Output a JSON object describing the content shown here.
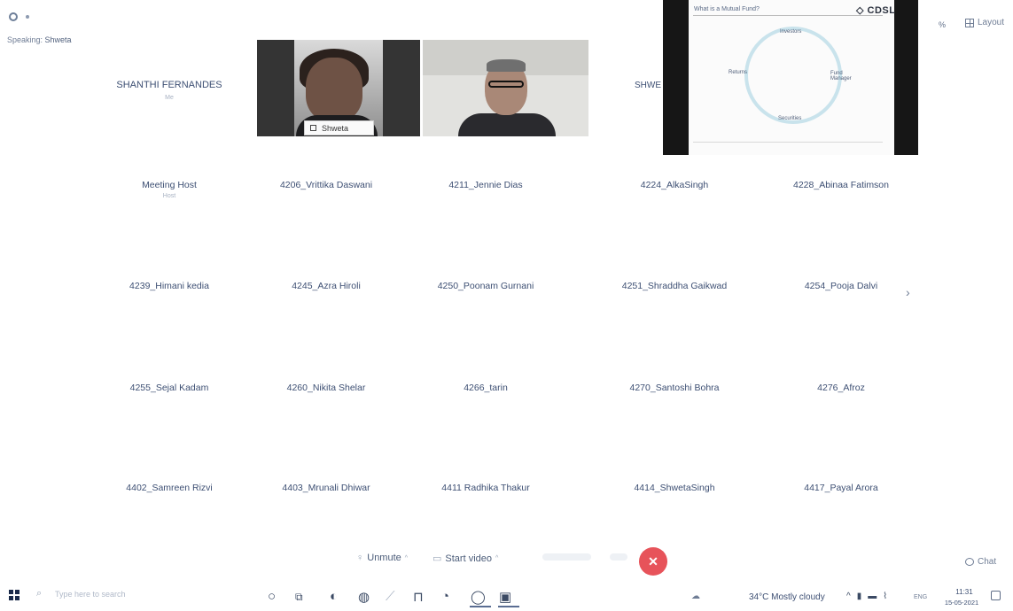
{
  "status": {
    "speaking_prefix": "Speaking:",
    "speaking_name": "Shweta"
  },
  "topbar": {
    "percent_icon": "%",
    "layout_label": "Layout"
  },
  "top_row": {
    "host_name": "SHANTHI FERNANDES",
    "host_sub": "Me",
    "video1_label": "Shweta",
    "presenter_partial": "SHWE"
  },
  "shared_slide": {
    "title": "What is a Mutual Fund?",
    "brand": "◇ CDSL",
    "labels": {
      "top": "Investors",
      "right": "Fund Manager",
      "bottom": "Securities",
      "left": "Returns"
    }
  },
  "participants": [
    [
      "Meeting Host",
      "4206_Vrittika Daswani",
      "4211_Jennie Dias",
      "4224_AlkaSingh",
      "4228_Abinaa Fatimson"
    ],
    [
      "4239_Himani kedia",
      "4245_Azra Hiroli",
      "4250_Poonam Gurnani",
      "4251_Shraddha Gaikwad",
      "4254_Pooja Dalvi"
    ],
    [
      "4255_Sejal Kadam",
      "4260_Nikita Shelar",
      "4266_tarin",
      "4270_Santoshi Bohra",
      "4276_Afroz"
    ],
    [
      "4402_Samreen Rizvi",
      "4403_Mrunali Dhiwar",
      "4411 Radhika Thakur",
      "4414_ShwetaSingh",
      "4417_Payal Arora"
    ]
  ],
  "meeting_host_sub": "Host",
  "toolbar": {
    "unmute": "Unmute",
    "start_video": "Start video",
    "leave": "✕",
    "chat": "Chat"
  },
  "taskbar": {
    "search_placeholder": "Type here to search",
    "weather": "34°C  Mostly cloudy",
    "lang": "ENG",
    "time": "11:31",
    "date": "15-05-2021"
  }
}
